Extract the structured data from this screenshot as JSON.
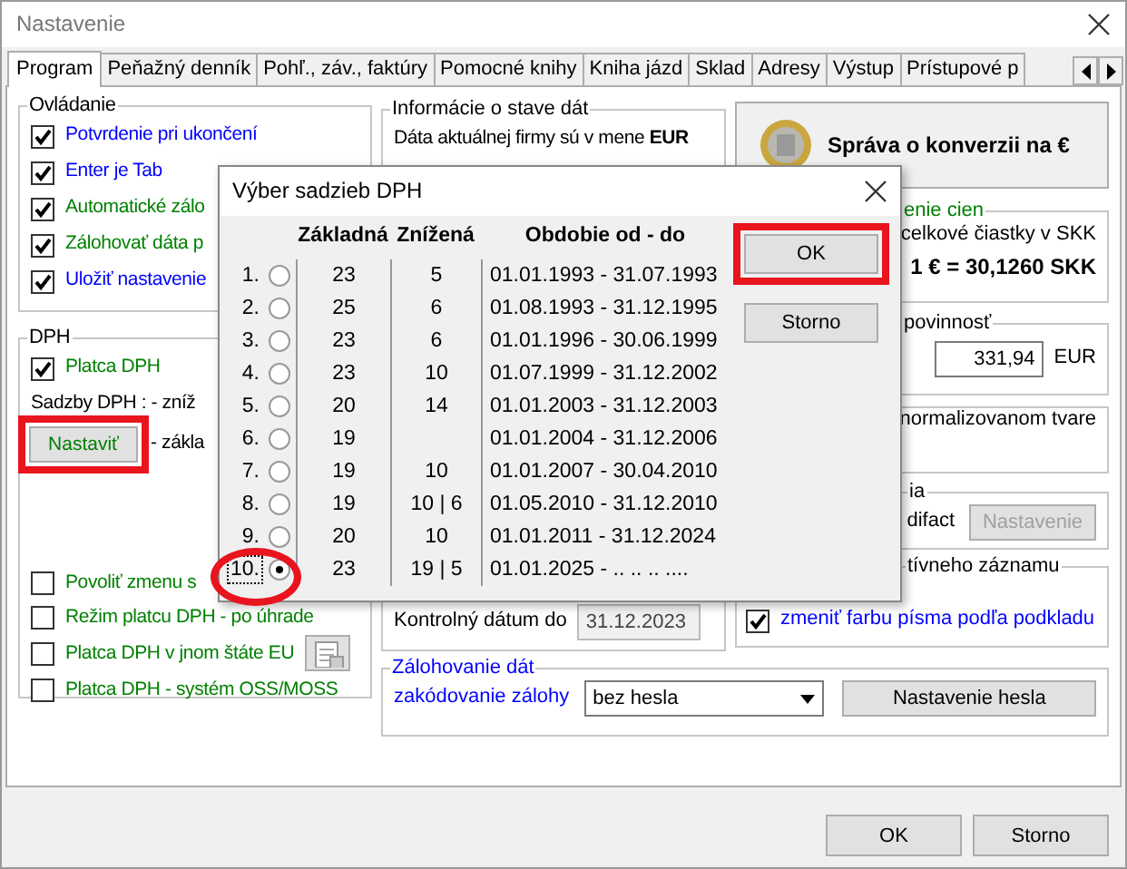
{
  "window": {
    "title": "Nastavenie"
  },
  "tabs": [
    {
      "label": "Program",
      "selected": true
    },
    {
      "label": "Peňažný denník",
      "selected": false
    },
    {
      "label": "Pohľ., záv., faktúry",
      "selected": false
    },
    {
      "label": "Pomocné knihy",
      "selected": false
    },
    {
      "label": "Kniha jázd",
      "selected": false
    },
    {
      "label": "Sklad",
      "selected": false
    },
    {
      "label": "Adresy",
      "selected": false
    },
    {
      "label": "Výstup",
      "selected": false
    },
    {
      "label": "Prístupové p",
      "selected": false
    }
  ],
  "controls_group": {
    "title": "Ovládanie",
    "items": [
      {
        "label": "Potvrdenie pri ukončení",
        "checked": true,
        "color": "#0000ff"
      },
      {
        "label": "Enter je Tab",
        "checked": true,
        "color": "#0000ff"
      },
      {
        "label": "Automatické zálo",
        "checked": true,
        "color": "#008000"
      },
      {
        "label": "Zálohovať dáta p",
        "checked": true,
        "color": "#008000"
      },
      {
        "label": "Uložiť nastavenie",
        "checked": true,
        "color": "#0000ff"
      }
    ]
  },
  "vat_group": {
    "title": "DPH",
    "payer": {
      "label": "Platca DPH",
      "checked": true
    },
    "rates_label": "Sadzby DPH : - zníž",
    "button": {
      "label": "Nastaviť",
      "highlighted": true
    },
    "basic_label": "- zákla",
    "options": [
      {
        "kind": "checkbox",
        "label": "Povoliť zmenu s",
        "checked": false
      },
      {
        "kind": "checkbox",
        "label": "Režim platcu DPH - po úhrade",
        "checked": false
      },
      {
        "kind": "checkbox_icon",
        "label": "Platca DPH v jnom štáte EU",
        "checked": false
      },
      {
        "kind": "checkbox",
        "label": "Platca DPH - systém OSS/MOSS",
        "checked": false
      }
    ]
  },
  "info_group": {
    "title": "Informácie o stave dát",
    "currency_text": "Dáta aktuálnej firmy sú v mene **EUR**",
    "control_date": {
      "label": "Kontrolný dátum do",
      "value": "31.12.2023",
      "disabled": true
    }
  },
  "backup_group": {
    "title": "Zálohovanie dát",
    "encoding_label": "zakódovanie zálohy",
    "encoding_value": "bez hesla",
    "button": "Nastavenie hesla"
  },
  "conversion_button": "Správa o konverzii na €",
  "rounding_group": {
    "title": "enie cien",
    "line": "celkové čiastky v SKK",
    "rate": "1 € = 30,1260 SKK"
  },
  "tax_group": {
    "title": "povinnosť",
    "value": "331,94",
    "currency": "EUR"
  },
  "normalized_text": "normalizovanom tvare",
  "edifact_group": {
    "title": "ia",
    "label": "difact",
    "button": {
      "label": "Nastavenie",
      "disabled": true
    }
  },
  "record_group": {
    "title": "tívneho záznamu",
    "checkbox": {
      "label": "zmeniť farbu písma podľa podkladu",
      "checked": true
    }
  },
  "dialog": {
    "title": "Výber sadzieb DPH",
    "columns": [
      "Základná",
      "Znížená",
      "Obdobie od - do"
    ],
    "rows": [
      {
        "number": "1.",
        "selected": false,
        "highlighted": false,
        "basic": "23",
        "reduced": "5",
        "period": "01.01.1993 - 31.07.1993"
      },
      {
        "number": "2.",
        "selected": false,
        "highlighted": false,
        "basic": "25",
        "reduced": "6",
        "period": "01.08.1993 - 31.12.1995"
      },
      {
        "number": "3.",
        "selected": false,
        "highlighted": false,
        "basic": "23",
        "reduced": "6",
        "period": "01.01.1996 - 30.06.1999"
      },
      {
        "number": "4.",
        "selected": false,
        "highlighted": false,
        "basic": "23",
        "reduced": "10",
        "period": "01.07.1999 - 31.12.2002"
      },
      {
        "number": "5.",
        "selected": false,
        "highlighted": false,
        "basic": "20",
        "reduced": "14",
        "period": "01.01.2003 - 31.12.2003"
      },
      {
        "number": "6.",
        "selected": false,
        "highlighted": false,
        "basic": "19",
        "period": "01.01.2004 - 31.12.2006"
      },
      {
        "number": "7.",
        "selected": false,
        "highlighted": false,
        "basic": "19",
        "reduced": "10",
        "period": "01.01.2007 - 30.04.2010"
      },
      {
        "number": "8.",
        "selected": false,
        "highlighted": false,
        "basic": "19",
        "reduced": "10 | 6",
        "period": "01.05.2010 - 31.12.2010"
      },
      {
        "number": "9.",
        "selected": false,
        "highlighted": false,
        "basic": "20",
        "reduced": "10",
        "period": "01.01.2011 - 31.12.2024"
      },
      {
        "number": "10.",
        "selected": true,
        "highlighted": true,
        "basic": "23",
        "reduced": "19 | 5",
        "period": "01.01.2025 - .. .. .. ...."
      }
    ],
    "buttons": [
      {
        "label": "OK",
        "highlighted": true
      },
      {
        "label": "Storno",
        "highlighted": false
      }
    ]
  },
  "footer_buttons": [
    "OK",
    "Storno"
  ]
}
